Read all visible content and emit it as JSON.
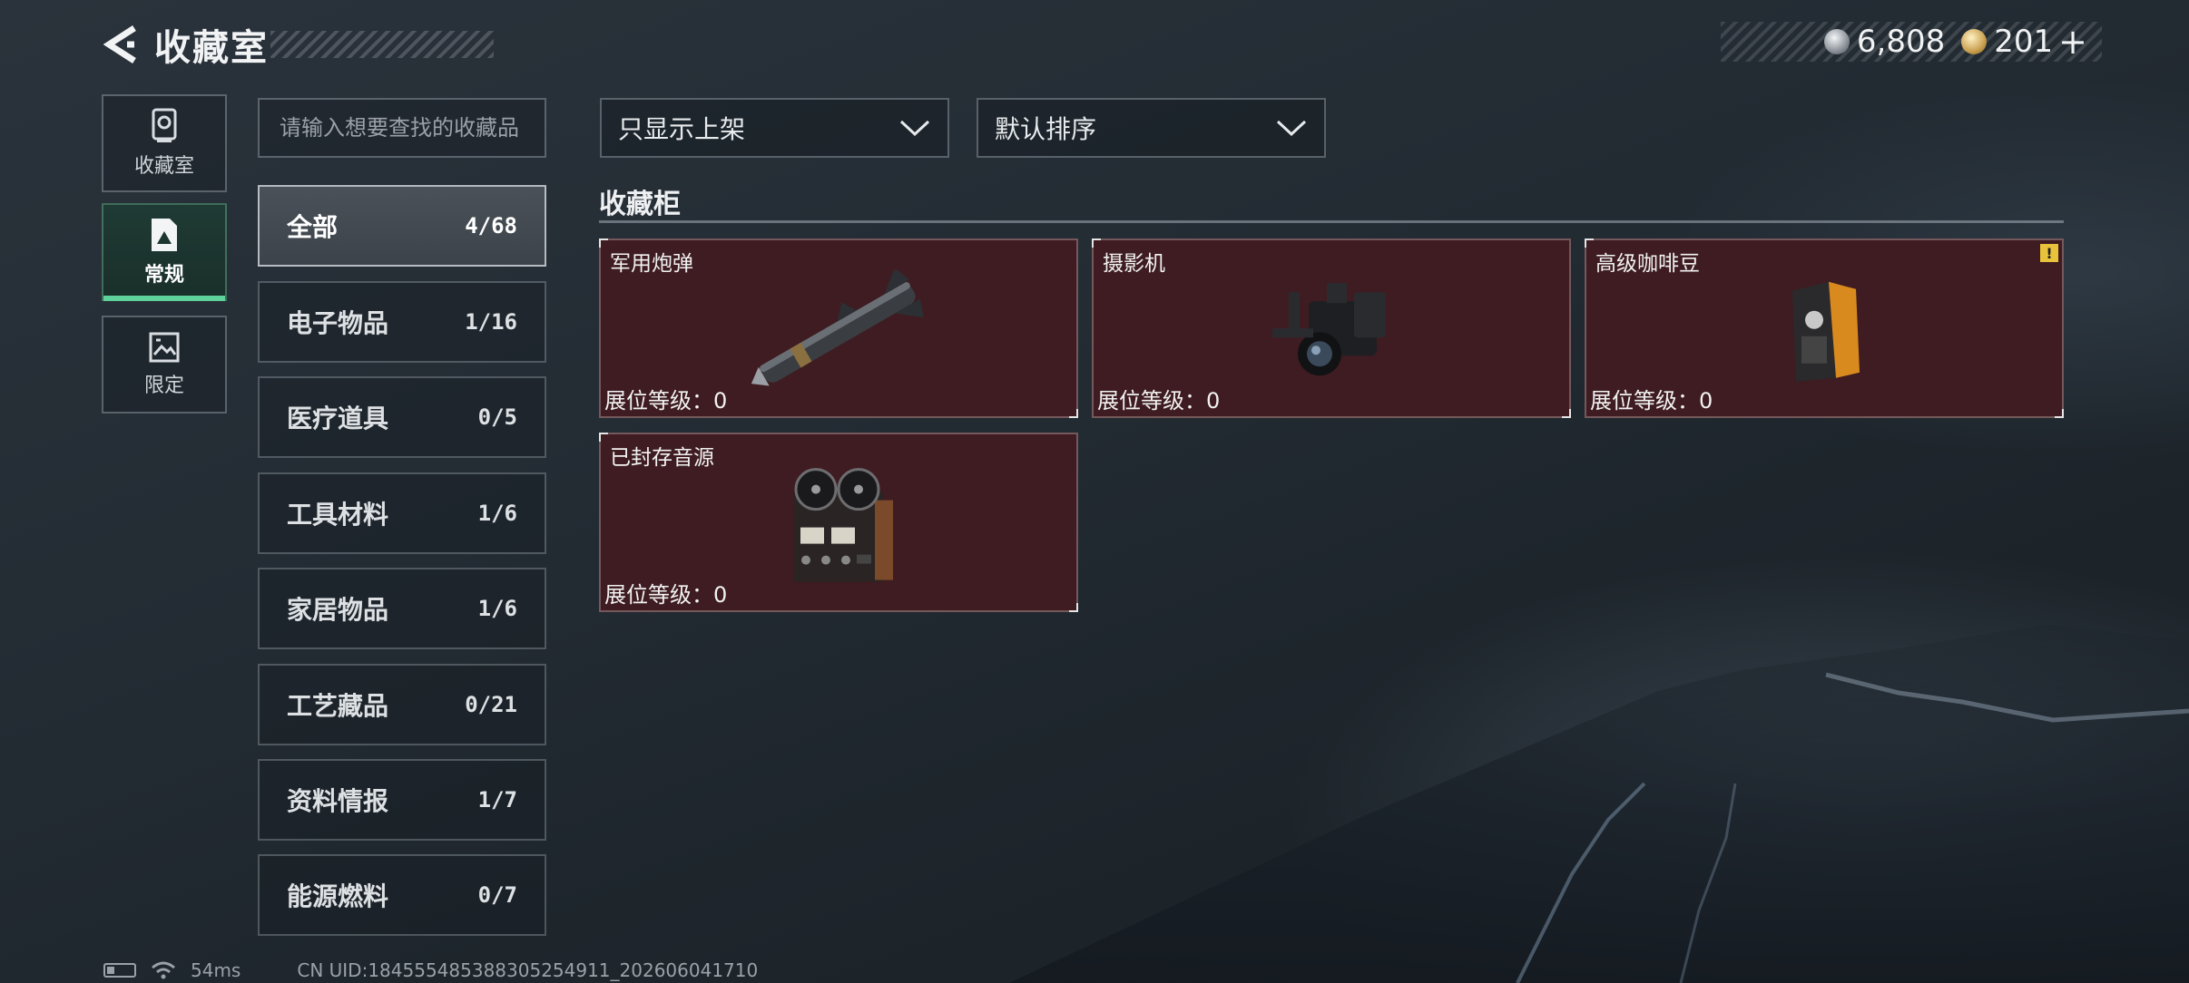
{
  "header": {
    "title": "收藏室"
  },
  "currency": [
    {
      "icon": "silver-coin-icon",
      "value": "6,808"
    },
    {
      "icon": "gold-coin-icon",
      "value": "201"
    }
  ],
  "side_tabs": [
    {
      "label": "收藏室",
      "icon": "trophy-icon"
    },
    {
      "label": "常规",
      "icon": "document-icon",
      "active": true
    },
    {
      "label": "限定",
      "icon": "image-icon"
    }
  ],
  "search": {
    "placeholder": "请输入想要查找的收藏品"
  },
  "categories": [
    {
      "name": "全部",
      "count": "4/68",
      "active": true
    },
    {
      "name": "电子物品",
      "count": "1/16"
    },
    {
      "name": "医疗道具",
      "count": "0/5"
    },
    {
      "name": "工具材料",
      "count": "1/6"
    },
    {
      "name": "家居物品",
      "count": "1/6"
    },
    {
      "name": "工艺藏品",
      "count": "0/21"
    },
    {
      "name": "资料情报",
      "count": "1/7"
    },
    {
      "name": "能源燃料",
      "count": "0/7"
    }
  ],
  "filters": {
    "display": "只显示上架",
    "sort": "默认排序"
  },
  "section": {
    "title": "收藏柜"
  },
  "items": [
    {
      "name": "军用炮弹",
      "level": "展位等级：0",
      "icon": "missile-icon"
    },
    {
      "name": "摄影机",
      "level": "展位等级：0",
      "icon": "camera-icon"
    },
    {
      "name": "高级咖啡豆",
      "level": "展位等级：0",
      "icon": "coffee-bag-icon",
      "warning": "!"
    },
    {
      "name": "已封存音源",
      "level": "展位等级：0",
      "icon": "tape-recorder-icon"
    }
  ],
  "status_bar": {
    "ping": "54ms",
    "uid": "CN UID:184555485388305254911_202606041710"
  },
  "colors": {
    "accent": "#5fd19a",
    "card_bg": "#3e1c21",
    "warning": "#e8c23a"
  }
}
